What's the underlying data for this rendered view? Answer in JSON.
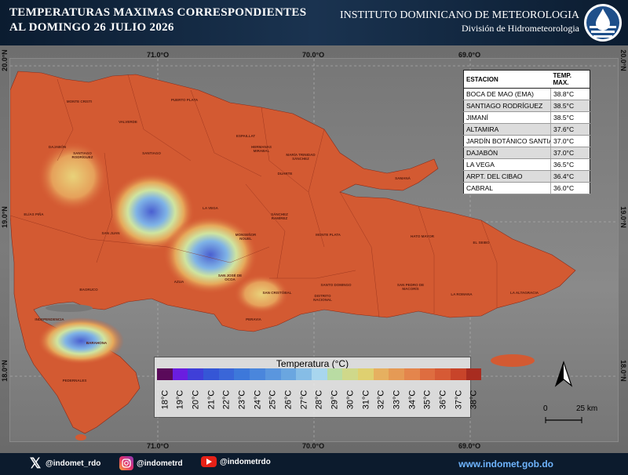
{
  "header": {
    "title_line1": "TEMPERATURAS MAXIMAS CORRESPONDIENTES",
    "title_line2": "AL DOMINGO 26  JULIO 2026",
    "institute": "INSTITUTO DOMINICANO DE METEOROLOGIA",
    "division": "División de Hidrometeorologia"
  },
  "axes": {
    "lon_ticks": [
      "71.0°O",
      "70.0°O",
      "69.0°O"
    ],
    "lat_ticks": [
      "20.0°N",
      "19.0°N",
      "18.0°N"
    ]
  },
  "table": {
    "col_station": "ESTACION",
    "col_temp": "TEMP. MAX.",
    "rows": [
      {
        "station": "BOCA DE MAO (EMA)",
        "temp": "38.8°C"
      },
      {
        "station": "SANTIAGO RODRÍGUEZ",
        "temp": "38.5°C"
      },
      {
        "station": "JIMANÍ",
        "temp": "38.5°C"
      },
      {
        "station": "ALTAMIRA",
        "temp": "37.6°C"
      },
      {
        "station": "JARDÍN BOTÁNICO SANTIAGO",
        "temp": "37.0°C"
      },
      {
        "station": "DAJABÓN",
        "temp": "37.0°C"
      },
      {
        "station": "LA VEGA",
        "temp": "36.5°C"
      },
      {
        "station": "ARPT. DEL CIBAO",
        "temp": "36.4°C"
      },
      {
        "station": "CABRAL",
        "temp": "36.0°C"
      }
    ]
  },
  "legend": {
    "title": "Temperatura (°C)",
    "labels": [
      "18°C",
      "19°C",
      "20°C",
      "21°C",
      "22°C",
      "23°C",
      "24°C",
      "25°C",
      "26°C",
      "27°C",
      "28°C",
      "29°C",
      "30°C",
      "31°C",
      "32°C",
      "33°C",
      "34°C",
      "35°C",
      "36°C",
      "37°C",
      "38°C"
    ],
    "colors": [
      "#5a0a5a",
      "#6a1de0",
      "#3f3fd8",
      "#3556d6",
      "#3a66d8",
      "#3d78da",
      "#4a86dc",
      "#5a96de",
      "#6aa6e0",
      "#86bde6",
      "#a8d6ee",
      "#b9dca3",
      "#cfd88a",
      "#dfd070",
      "#e6b060",
      "#e59a55",
      "#e4854c",
      "#de6d40",
      "#d65a35",
      "#c8442a",
      "#a82c20"
    ]
  },
  "scale": {
    "zero": "0",
    "dist": "25 km"
  },
  "places": [
    "MONTE CRISTI",
    "PUERTO PLATA",
    "VALVERDE",
    "SANTIAGO",
    "ESPAILLAT",
    "HERMANAS MIRABAL",
    "MARÍA TRINIDAD SÁNCHEZ",
    "SAMANÁ",
    "DUARTE",
    "LA VEGA",
    "SÁNCHEZ RAMÍREZ",
    "MONSEÑOR NOUEL",
    "MONTE PLATA",
    "HATO MAYOR",
    "EL SEIBO",
    "LA ALTAGRACIA",
    "LA ROMANA",
    "SAN PEDRO DE MACORÍS",
    "SANTO DOMINGO",
    "DISTRITO NACIONAL",
    "SAN CRISTÓBAL",
    "PERAVIA",
    "SAN JOSÉ DE OCOA",
    "AZUA",
    "SAN JUAN",
    "ELÍAS PIÑA",
    "DAJABÓN",
    "SANTIAGO RODRÍGUEZ",
    "BAORUCO",
    "INDEPENDENCIA",
    "BARAHONA",
    "PEDERNALES"
  ],
  "footer": {
    "x": "@indomet_rdo",
    "instagram": "@indometrd",
    "youtube": "@indometrdo",
    "web": "www.indomet.gob.do"
  }
}
